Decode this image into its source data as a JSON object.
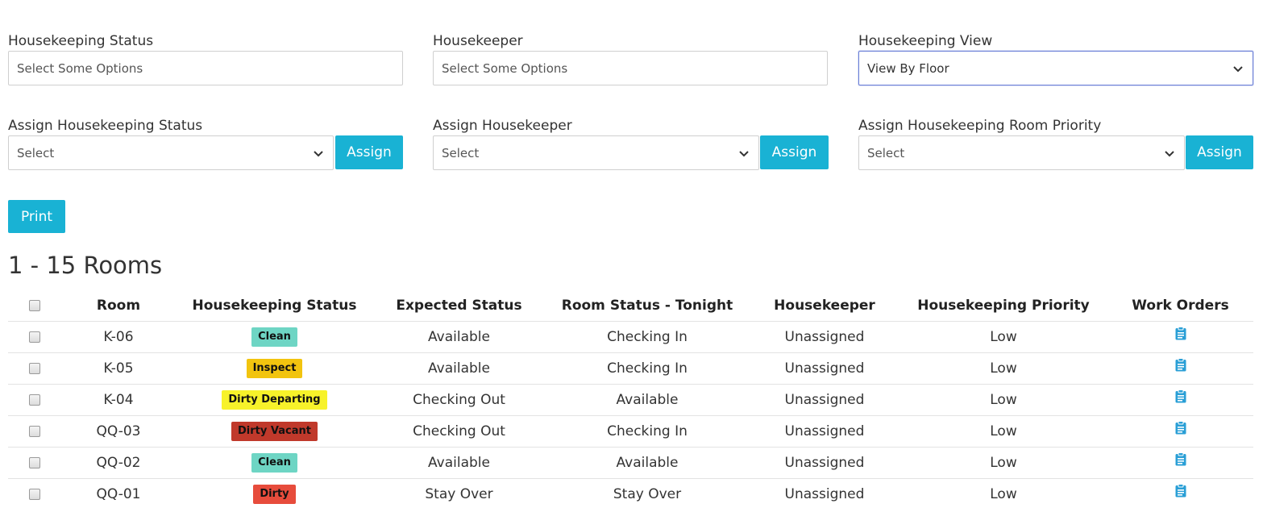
{
  "filters": {
    "housekeeping_status": {
      "label": "Housekeeping Status",
      "placeholder": "Select Some Options"
    },
    "housekeeper": {
      "label": "Housekeeper",
      "placeholder": "Select Some Options"
    },
    "housekeeping_view": {
      "label": "Housekeeping View",
      "value": "View By Floor"
    }
  },
  "assign": {
    "status": {
      "label": "Assign Housekeeping Status",
      "value": "Select",
      "button": "Assign"
    },
    "housekeeper": {
      "label": "Assign Housekeeper",
      "value": "Select",
      "button": "Assign"
    },
    "priority": {
      "label": "Assign Housekeeping Room Priority",
      "value": "Select",
      "button": "Assign"
    }
  },
  "print_label": "Print",
  "heading": "1 - 15 Rooms",
  "colors": {
    "accent": "#19b2d4",
    "clean": "#6ed5c4",
    "inspect": "#f2c40f",
    "dirty_departing": "#f7f22a",
    "dirty_vacant": "#c0392b",
    "dirty": "#e74c3c",
    "icon": "#2a9fd6"
  },
  "table": {
    "headers": [
      "Room",
      "Housekeeping Status",
      "Expected Status",
      "Room Status - Tonight",
      "Housekeeper",
      "Housekeeping Priority",
      "Work Orders"
    ],
    "rows": [
      {
        "room": "K-06",
        "status": "Clean",
        "status_color": "#6ed5c4",
        "expected": "Available",
        "tonight": "Checking In",
        "housekeeper": "Unassigned",
        "priority": "Low",
        "work_order_icon": "clipboard-icon"
      },
      {
        "room": "K-05",
        "status": "Inspect",
        "status_color": "#f2c40f",
        "expected": "Available",
        "tonight": "Checking In",
        "housekeeper": "Unassigned",
        "priority": "Low",
        "work_order_icon": "clipboard-icon"
      },
      {
        "room": "K-04",
        "status": "Dirty Departing",
        "status_color": "#f7f22a",
        "expected": "Checking Out",
        "tonight": "Available",
        "housekeeper": "Unassigned",
        "priority": "Low",
        "work_order_icon": "clipboard-icon"
      },
      {
        "room": "QQ-03",
        "status": "Dirty Vacant",
        "status_color": "#c0392b",
        "expected": "Checking Out",
        "tonight": "Checking In",
        "housekeeper": "Unassigned",
        "priority": "Low",
        "work_order_icon": "clipboard-icon"
      },
      {
        "room": "QQ-02",
        "status": "Clean",
        "status_color": "#6ed5c4",
        "expected": "Available",
        "tonight": "Available",
        "housekeeper": "Unassigned",
        "priority": "Low",
        "work_order_icon": "clipboard-icon"
      },
      {
        "room": "QQ-01",
        "status": "Dirty",
        "status_color": "#e74c3c",
        "expected": "Stay Over",
        "tonight": "Stay Over",
        "housekeeper": "Unassigned",
        "priority": "Low",
        "work_order_icon": "clipboard-icon"
      }
    ]
  }
}
